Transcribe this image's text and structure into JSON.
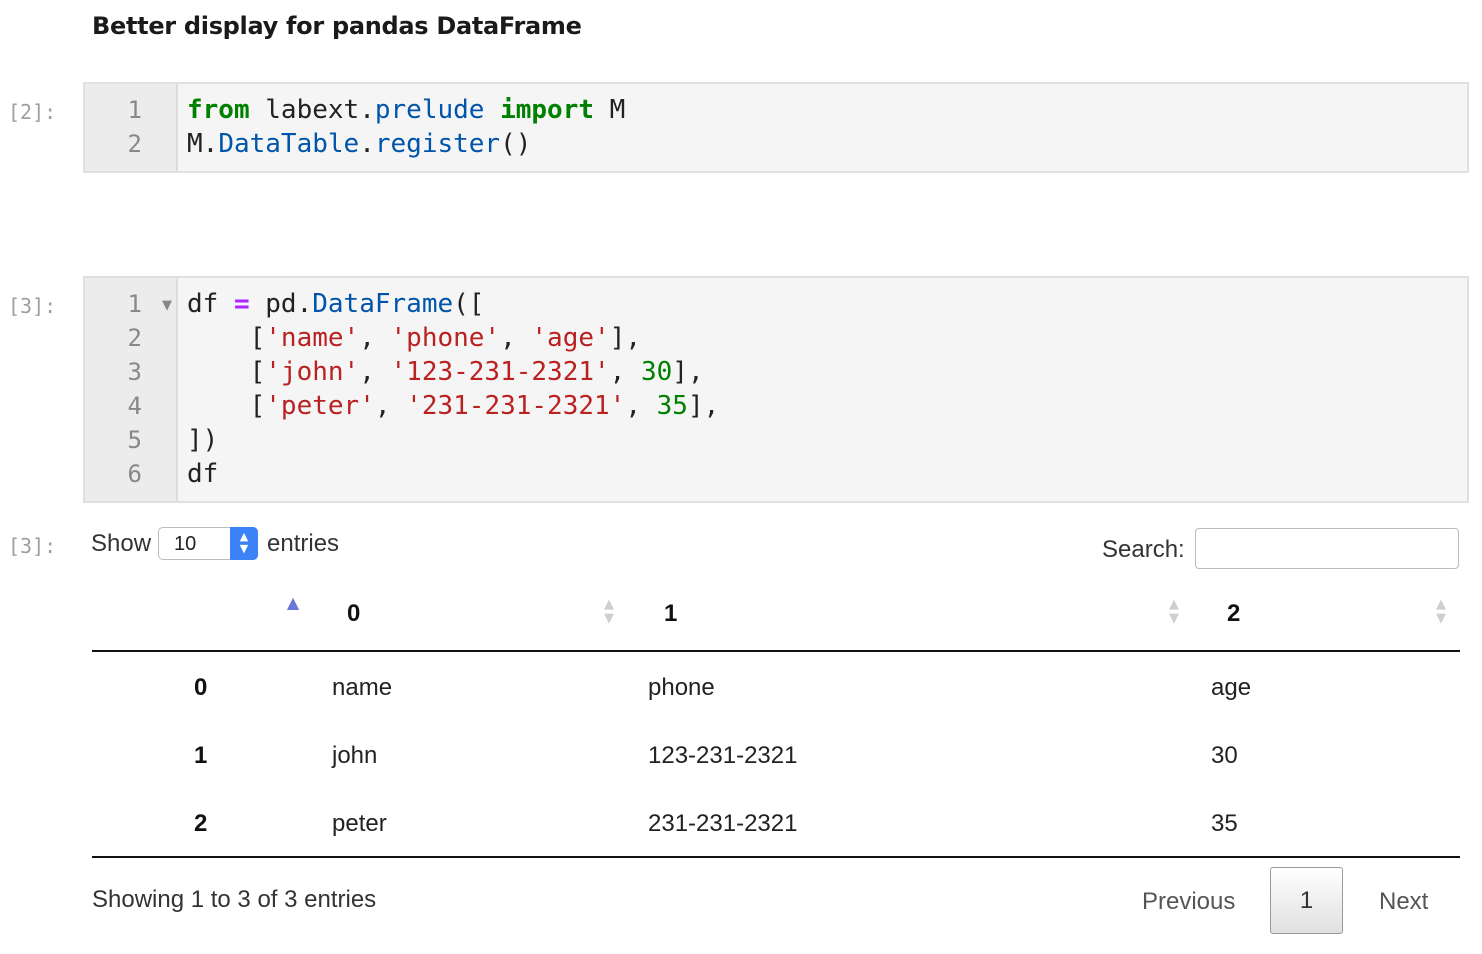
{
  "heading": "Better display for pandas DataFrame",
  "cell1": {
    "prompt": "[2]:",
    "line_numbers": [
      "1",
      "2"
    ]
  },
  "cell2": {
    "prompt": "[3]:",
    "line_numbers": [
      "1",
      "2",
      "3",
      "4",
      "5",
      "6"
    ]
  },
  "output": {
    "prompt": "[3]:",
    "show_label": "Show",
    "entries_value": "10",
    "entries_label": "entries",
    "search_label": "Search:",
    "search_value": "",
    "columns": [
      "0",
      "1",
      "2"
    ],
    "rows": [
      {
        "index": "0",
        "cells": [
          "name",
          "phone",
          "age"
        ]
      },
      {
        "index": "1",
        "cells": [
          "john",
          "123-231-2321",
          "30"
        ]
      },
      {
        "index": "2",
        "cells": [
          "peter",
          "231-231-2321",
          "35"
        ]
      }
    ],
    "info": "Showing 1 to 3 of 3 entries",
    "pagination": {
      "previous": "Previous",
      "current_page": "1",
      "next": "Next"
    }
  },
  "colors": {
    "keyword": "#008000",
    "module": "#0055aa",
    "string": "#ba2121",
    "operator": "#aa22ff",
    "select_button": "#3b82f6",
    "sort_active": "#6a76d8"
  },
  "icons": [
    "fold-arrow-icon",
    "select-stepper-icon",
    "sort-asc-icon",
    "sort-both-icon"
  ]
}
